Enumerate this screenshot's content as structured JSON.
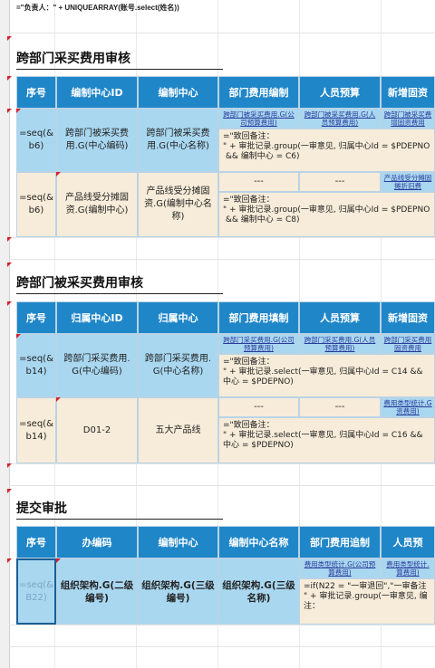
{
  "top_formula": "=\"负责人：\" + UNIQUEARRAY(账号.select(姓名))",
  "section1": {
    "title": "跨部门采买费用审核",
    "headers": [
      "序号",
      "编制中心ID",
      "编制中心",
      "部门费用编制",
      "人员预算",
      "新增固资"
    ],
    "row1": {
      "seq": "=seq(&\nb6)",
      "center_id": "跨部门被采买费\n用.G(中心编码)",
      "center": "跨部门被采买费\n用.G(中心名称)",
      "dept_fee": "跨部门被采买费用.G(公\n司预算费用)",
      "staff": "跨部门被采买费用.G(人\n员预算费用)",
      "asset": "跨部门被采买费\n增固资费用",
      "formula": "=\"致回备注：\n\" + 审批记录.group(一审意见, 归属中心Id = $PDEPNO\n && 编制中心 = C6)"
    },
    "row2": {
      "seq": "=seq(&\nb6)",
      "center_id": "产品线受分摊固\n资.G(编制中心)",
      "center": "产品线受分摊固\n资.G(编制中心名\n称)",
      "dept_fee": "---",
      "staff": "---",
      "asset": "产品线受分摊固\n摊折旧费",
      "formula": "=\"致回备注：\n\" + 审批记录.group(一审意见, 归属中心Id = $PDEPNO\n && 编制中心 = C8)"
    }
  },
  "section2": {
    "title": "跨部门被采买费用审核",
    "headers": [
      "序号",
      "归属中心ID",
      "归属中心",
      "部门费用填制",
      "人员预算",
      "新增固资"
    ],
    "row1": {
      "seq": "=seq(&\nb14)",
      "center_id": "跨部门采买费用.\nG(中心编码)",
      "center": "跨部门采买费用.\nG(中心名称)",
      "dept_fee": "跨部门采买费用.G(公司\n预算费用)",
      "staff": "跨部门采买费用.G(人员\n预算费用)",
      "asset": "跨部门采买费用\n固资费用",
      "formula": "=\"致回备注：\n\" + 审批记录.select(一审意见, 归属中心Id = C14 &&\n中心 = $PDEPNO)"
    },
    "row2": {
      "seq": "=seq(&\nb14)",
      "center_id": "D01-2",
      "center": "五大产品线",
      "dept_fee": "---",
      "staff": "---",
      "asset": "费用类型统计.G\n资费用)",
      "formula": "=\"致回备注：\n\" + 审批记录.select(一审意见, 归属中心Id = C16 &&\n中心 = $PDEPNO)"
    }
  },
  "section3": {
    "title": "提交审批",
    "headers": [
      "序号",
      "办编码",
      "编制中心",
      "编制中心名称",
      "部门费用追制",
      "人员预"
    ],
    "row1": {
      "seq": "=seq(&\nB22)",
      "code": "组织架构.G(二级\n编号)",
      "center": "组织架构.G(三级\n编号)",
      "center_name": "组织架构.G(三级\n名称)",
      "dept_fee": "费用类型统计.G(公司预\n算费用)",
      "staff": "费用类型统计.\n算费用)",
      "formula": "=if(N22 = \"一审退回\",\"一审备注\n\" + 审批记录.group(一审意见, 编\n注："
    }
  }
}
